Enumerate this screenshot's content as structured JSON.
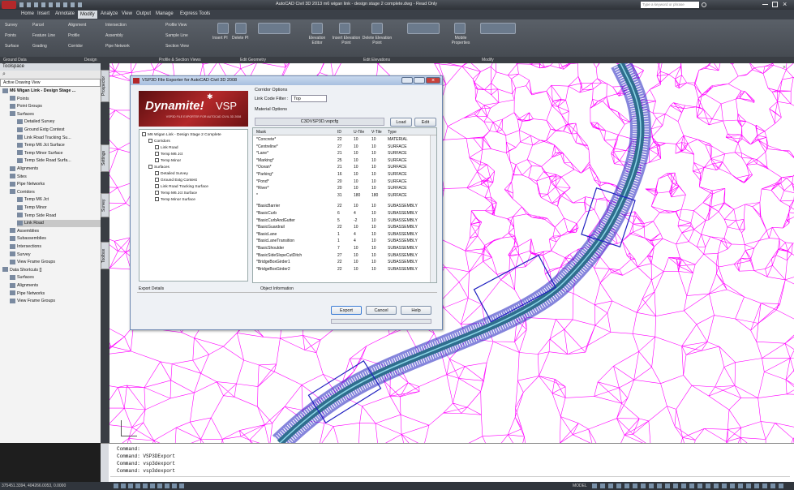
{
  "title_bar": {
    "title": "AutoCAD Civil 3D 2013    m6 wigan link - design stage 2 complete.dwg - Read Only",
    "search_placeholder": "Type a keyword or phrase"
  },
  "tabs": [
    "Home",
    "Insert",
    "Annotate",
    "Modify",
    "Analyze",
    "View",
    "Output",
    "Manage",
    "Express Tools"
  ],
  "active_tab": "Modify",
  "ribbon": {
    "col1": [
      "Survey",
      "Points",
      "Surface"
    ],
    "col2": [
      "Parcel",
      "Feature Line",
      "Grading"
    ],
    "col3": [
      "Alignment",
      "Profile",
      "Corridor"
    ],
    "col4": [
      "Intersection",
      "Assembly",
      "Pipe Network"
    ],
    "col5": [
      "Profile View",
      "Sample Line",
      "Section View"
    ],
    "geom_labels": [
      "Insert PI",
      "Delete PI"
    ],
    "elev_labels": [
      "Elevation Editor",
      "Insert Elevation Point",
      "Delete Elevation Point"
    ],
    "modify_labels": [
      "Mobile Properties"
    ]
  },
  "panel_labels": [
    "Ground Data",
    "Design",
    "Profile & Section Views",
    "Edit Geometry",
    "Edit Elevations",
    "Modify"
  ],
  "toolspace": {
    "title": "Toolspace",
    "view_select": "Active Drawing View",
    "tree": [
      {
        "label": "M6 Wigan Link - Design Stage ...",
        "level": 0,
        "bold": true
      },
      {
        "label": "Points",
        "level": 1
      },
      {
        "label": "Point Groups",
        "level": 1
      },
      {
        "label": "Surfaces",
        "level": 1
      },
      {
        "label": "Detailed Survey",
        "level": 2
      },
      {
        "label": "Ground Extg Contest",
        "level": 2
      },
      {
        "label": "Link Road Tracking Su...",
        "level": 2
      },
      {
        "label": "Temp M6 Jct Surface",
        "level": 2
      },
      {
        "label": "Temp Minor Surface",
        "level": 2
      },
      {
        "label": "Temp Side Road Surfa...",
        "level": 2
      },
      {
        "label": "Alignments",
        "level": 1
      },
      {
        "label": "Sites",
        "level": 1
      },
      {
        "label": "Pipe Networks",
        "level": 1
      },
      {
        "label": "Corridors",
        "level": 1
      },
      {
        "label": "Temp M6 Jct",
        "level": 2
      },
      {
        "label": "Temp Minor",
        "level": 2
      },
      {
        "label": "Temp Side Road",
        "level": 2
      },
      {
        "label": "Link Road",
        "level": 2,
        "selected": true
      },
      {
        "label": "Assemblies",
        "level": 1
      },
      {
        "label": "Subassemblies",
        "level": 1
      },
      {
        "label": "Intersections",
        "level": 1
      },
      {
        "label": "Survey",
        "level": 1
      },
      {
        "label": "View Frame Groups",
        "level": 1
      },
      {
        "label": "Data Shortcuts []",
        "level": 0
      },
      {
        "label": "Surfaces",
        "level": 1
      },
      {
        "label": "Alignments",
        "level": 1
      },
      {
        "label": "Pipe Networks",
        "level": 1
      },
      {
        "label": "View Frame Groups",
        "level": 1
      }
    ],
    "side_tabs": [
      "Prospector",
      "Settings",
      "Survey",
      "Toolbox"
    ]
  },
  "dialog": {
    "title": "VSP3D File Exporter for AutoCAD Civil 3D 2008",
    "logo_text": "Dynamite!",
    "logo_brand": "VSP",
    "logo_sub": "VSP3D FILE EXPORTER FOR AUTOCAD CIVIL 3D 2008",
    "corridor_options": "Corridor Options",
    "link_code_filter_label": "Link Code Filter :",
    "link_code_filter_value": "Top",
    "material_options": "Material Options",
    "config_file": "C3DVSP3D.vspcfg",
    "load_label": "Load",
    "edit_label": "Edit",
    "tree": [
      {
        "label": "M6 Wigan Link - Design Stage 2 Complete",
        "level": 0
      },
      {
        "label": "Corridors",
        "level": 1
      },
      {
        "label": "Link Road",
        "level": 2
      },
      {
        "label": "Temp M6 Jct",
        "level": 2
      },
      {
        "label": "Temp Minor",
        "level": 2
      },
      {
        "label": "Surfaces",
        "level": 1
      },
      {
        "label": "Detailed Survey",
        "level": 2
      },
      {
        "label": "Ground Extg Contest",
        "level": 2
      },
      {
        "label": "Link Road Tracking Surface",
        "level": 2
      },
      {
        "label": "Temp M6 Jct Surface",
        "level": 2
      },
      {
        "label": "Temp Minor Surface",
        "level": 2
      }
    ],
    "columns": [
      "Mask",
      "ID",
      "U-Tile",
      "V-Tile",
      "Type"
    ],
    "rows": [
      [
        "*Concrete*",
        "22",
        "10",
        "10",
        "MATERIAL"
      ],
      [
        "*Centreline*",
        "27",
        "10",
        "10",
        "SURFACE"
      ],
      [
        "*Lane*",
        "21",
        "10",
        "10",
        "SURFACE"
      ],
      [
        "*Marking*",
        "25",
        "10",
        "10",
        "SURFACE"
      ],
      [
        "*Ocean*",
        "21",
        "10",
        "10",
        "SURFACE"
      ],
      [
        "*Parking*",
        "16",
        "10",
        "10",
        "SURFACE"
      ],
      [
        "*Pond*",
        "20",
        "10",
        "10",
        "SURFACE"
      ],
      [
        "*River*",
        "20",
        "10",
        "10",
        "SURFACE"
      ],
      [
        "*",
        "31",
        "180",
        "180",
        "SURFACE"
      ],
      [
        "*BasicBarrier",
        "22",
        "10",
        "10",
        "SUBASSEMBLY"
      ],
      [
        "*BasicCurb",
        "6",
        "4",
        "10",
        "SUBASSEMBLY"
      ],
      [
        "*BasicCurbAndGutter",
        "5",
        "-2",
        "10",
        "SUBASSEMBLY"
      ],
      [
        "*BasicGuardrail",
        "22",
        "10",
        "10",
        "SUBASSEMBLY"
      ],
      [
        "*BasicLane",
        "1",
        "4",
        "10",
        "SUBASSEMBLY"
      ],
      [
        "*BasicLaneTransition",
        "1",
        "4",
        "10",
        "SUBASSEMBLY"
      ],
      [
        "*BasicShoulder",
        "7",
        "10",
        "10",
        "SUBASSEMBLY"
      ],
      [
        "*BasicSideSlopeCutDitch",
        "27",
        "10",
        "10",
        "SUBASSEMBLY"
      ],
      [
        "*BridgeBoxGirder1",
        "22",
        "10",
        "10",
        "SUBASSEMBLY"
      ],
      [
        "*BridgeBoxGirder2",
        "22",
        "10",
        "10",
        "SUBASSEMBLY"
      ]
    ],
    "export_details": "Export Details",
    "object_information": "Object Information",
    "export_label": "Export",
    "cancel_label": "Cancel",
    "help_label": "Help"
  },
  "command_lines": [
    "Command:",
    "Command: VSP3DExport",
    "Command: vsp3dexport",
    "Command: vsp3dexport"
  ],
  "status": {
    "coords": "375451.3394, 404266.0053, 0.0000",
    "model": "MODEL"
  },
  "colors": {
    "tin": "#ff00ff",
    "corridor_fill": "#2f6e8e",
    "corridor_outline": "#2020c0",
    "accent": "#b3282a"
  }
}
